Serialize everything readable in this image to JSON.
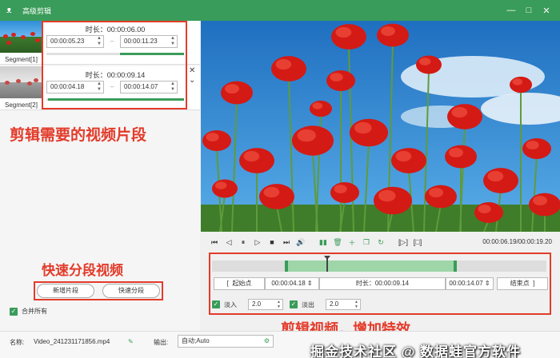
{
  "window": {
    "title": "高级剪辑",
    "icons": {
      "logo": "rabbit-logo-icon",
      "minimize": "minimize-icon",
      "maximize": "maximize-icon",
      "close": "close-icon"
    }
  },
  "segments": [
    {
      "label": "Segment[1]",
      "duration": "时长：00:00:06.00",
      "start": "00:00:05.23",
      "end": "00:00:11.23"
    },
    {
      "label": "Segment[2]",
      "duration": "时长：00:00:09.14",
      "start": "00:00:04.18",
      "end": "00:00:14.07"
    }
  ],
  "annotations": {
    "segments": "剪辑需要的视频片段",
    "quick": "快速分段视频",
    "effects": "剪辑视频，增加特效"
  },
  "left_buttons": {
    "add_segment": "新增片段",
    "quick_split": "快速分段"
  },
  "merge_all": {
    "label": "合并所有",
    "checked": true
  },
  "player": {
    "timecode": "00:00:06.19/00:00:19.20",
    "progress": 0.342
  },
  "editor": {
    "start_btn_label": "起始点",
    "start_value": "00:00:04.18",
    "duration_label": "时长：00:00:09.14",
    "end_value": "00:00:14.07",
    "end_btn_label": "结束点",
    "selection_start": 0.218,
    "selection_end": 0.733,
    "fade_in_label": "淡入",
    "fade_in_value": "2.0",
    "fade_out_label": "淡出",
    "fade_out_value": "2.0"
  },
  "bottom": {
    "name_label": "名称:",
    "name_value": "Video_241231171856.mp4",
    "output_label": "输出:",
    "output_value": "自动;Auto",
    "watermark": "掘金技术社区 @ 数据蛙官方软件"
  },
  "colors": {
    "accent": "#3a9c5a",
    "annotation": "#e33b2a"
  }
}
